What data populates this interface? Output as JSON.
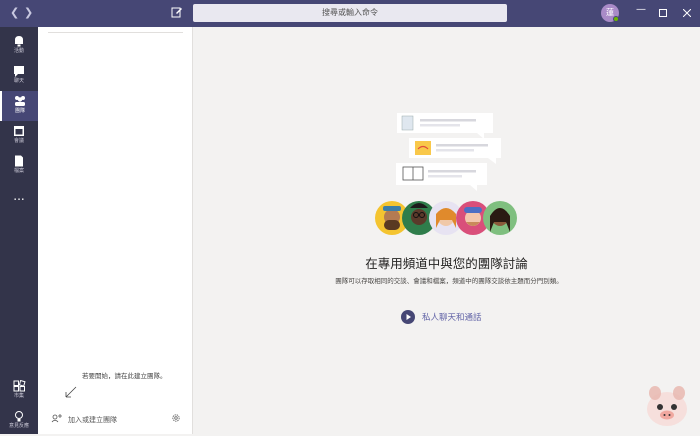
{
  "titlebar": {
    "search_placeholder": "搜尋或輸入命令",
    "avatar_initial": "蓮"
  },
  "rail": {
    "items": [
      {
        "label": "活動",
        "icon": "bell-icon"
      },
      {
        "label": "聊天",
        "icon": "chat-icon"
      },
      {
        "label": "團隊",
        "icon": "teams-icon",
        "active": true
      },
      {
        "label": "會議",
        "icon": "calendar-icon"
      },
      {
        "label": "檔案",
        "icon": "file-icon"
      },
      {
        "label": "...",
        "icon": "more-icon"
      }
    ],
    "bottom_items": [
      {
        "label": "市集",
        "icon": "apps-icon"
      },
      {
        "label": "意見反應",
        "icon": "feedback-icon"
      }
    ]
  },
  "panel": {
    "hint_text": "若要開始，請在此建立團隊。",
    "join_label": "加入或建立團隊"
  },
  "main": {
    "headline": "在專用頻道中與您的團隊討論",
    "description": "團隊可以存取相同的交談、會議和檔案，頻道中的團隊交談依主題而分門別類。",
    "chat_link": "私人聊天和通話"
  },
  "colors": {
    "brand": "#464775",
    "rail": "#33344a",
    "link": "#6264a7"
  }
}
